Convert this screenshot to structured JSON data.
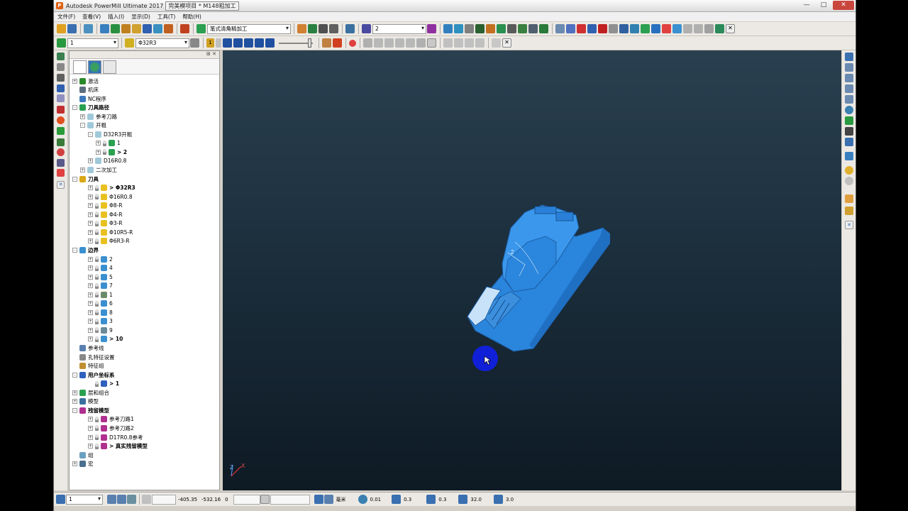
{
  "window": {
    "title": "Autodesk PowerMill Ultimate 2017",
    "project": "完美模项目 * M148粗加工",
    "controls": [
      "—",
      "□",
      "✕"
    ]
  },
  "menu": [
    "文件(F)",
    "查看(V)",
    "插入(I)",
    "显示(D)",
    "工具(T)",
    "帮助(H)"
  ],
  "toolbar1": {
    "strategy_combo": "笔式清角精加工",
    "number_combo": "2"
  },
  "toolbar2": {
    "workplane_combo": "1",
    "tool_combo": "Φ32R3",
    "toolpath_step": "1"
  },
  "explorer": {
    "tree": [
      {
        "label": "激活",
        "indent": 0,
        "expander": "+",
        "color": "#2a8a2a",
        "bold": false
      },
      {
        "label": "机床",
        "indent": 0,
        "expander": "",
        "color": "#5c6f80",
        "bold": false
      },
      {
        "label": "NC程序",
        "indent": 0,
        "expander": "",
        "color": "#3d7abf",
        "bold": false
      },
      {
        "label": "刀具路径",
        "indent": 0,
        "expander": "-",
        "color": "#2aa050",
        "bold": true
      },
      {
        "label": "参考刀路",
        "indent": 1,
        "expander": "+",
        "color": "#9fc9d9",
        "bold": false
      },
      {
        "label": "开粗",
        "indent": 1,
        "expander": "-",
        "color": "#9fc9d9",
        "bold": false
      },
      {
        "label": "D32R3开粗",
        "indent": 2,
        "expander": "-",
        "color": "#9fc9d9",
        "bold": false
      },
      {
        "label": "1",
        "indent": 3,
        "expander": "+",
        "color": "#2aa050",
        "bold": false,
        "bulb": true
      },
      {
        "label": "> 2",
        "indent": 3,
        "expander": "+",
        "color": "#2aa050",
        "bold": true,
        "bulb": true
      },
      {
        "label": "D16R0.8",
        "indent": 2,
        "expander": "+",
        "color": "#9fc9d9",
        "bold": false
      },
      {
        "label": "二次加工",
        "indent": 1,
        "expander": "+",
        "color": "#9fc9d9",
        "bold": false
      },
      {
        "label": "刀具",
        "indent": 0,
        "expander": "-",
        "color": "#d9a818",
        "bold": true
      },
      {
        "label": "> Φ32R3",
        "indent": 2,
        "expander": "+",
        "color": "#e8c020",
        "bold": true,
        "bulb": true
      },
      {
        "label": "Φ16R0.8",
        "indent": 2,
        "expander": "+",
        "color": "#e8c020",
        "bold": false,
        "bulb": true
      },
      {
        "label": "Φ8-R",
        "indent": 2,
        "expander": "+",
        "color": "#e8c020",
        "bold": false,
        "bulb": true
      },
      {
        "label": "Φ4-R",
        "indent": 2,
        "expander": "+",
        "color": "#e8c020",
        "bold": false,
        "bulb": true
      },
      {
        "label": "Φ3-R",
        "indent": 2,
        "expander": "+",
        "color": "#e8c020",
        "bold": false,
        "bulb": true
      },
      {
        "label": "Φ10R5-R",
        "indent": 2,
        "expander": "+",
        "color": "#e8c020",
        "bold": false,
        "bulb": true
      },
      {
        "label": "Φ6R3-R",
        "indent": 2,
        "expander": "+",
        "color": "#e8c020",
        "bold": false,
        "bulb": true
      },
      {
        "label": "边界",
        "indent": 0,
        "expander": "-",
        "color": "#3a8fd0",
        "bold": true
      },
      {
        "label": "2",
        "indent": 2,
        "expander": "+",
        "color": "#3a8fd0",
        "bold": false,
        "bulb": true
      },
      {
        "label": "4",
        "indent": 2,
        "expander": "+",
        "color": "#3a8fd0",
        "bold": false,
        "bulb": true
      },
      {
        "label": "5",
        "indent": 2,
        "expander": "+",
        "color": "#3a8fd0",
        "bold": false,
        "bulb": true
      },
      {
        "label": "7",
        "indent": 2,
        "expander": "+",
        "color": "#3a8fd0",
        "bold": false,
        "bulb": true
      },
      {
        "label": "1",
        "indent": 2,
        "expander": "+",
        "color": "#6a8a6a",
        "bold": false,
        "bulb": true
      },
      {
        "label": "6",
        "indent": 2,
        "expander": "+",
        "color": "#3a8fd0",
        "bold": false,
        "bulb": true
      },
      {
        "label": "8",
        "indent": 2,
        "expander": "+",
        "color": "#3a8fd0",
        "bold": false,
        "bulb": true
      },
      {
        "label": "3",
        "indent": 2,
        "expander": "+",
        "color": "#3a8fd0",
        "bold": false,
        "bulb": true
      },
      {
        "label": "9",
        "indent": 2,
        "expander": "+",
        "color": "#6a8a9a",
        "bold": false,
        "bulb": true
      },
      {
        "label": "> 10",
        "indent": 2,
        "expander": "+",
        "color": "#3a8fd0",
        "bold": true,
        "bulb": true
      },
      {
        "label": "参考线",
        "indent": 0,
        "expander": "",
        "color": "#5a7fb0",
        "bold": false
      },
      {
        "label": "孔特征设置",
        "indent": 0,
        "expander": "",
        "color": "#888888",
        "bold": false
      },
      {
        "label": "特征组",
        "indent": 0,
        "expander": "",
        "color": "#c09030",
        "bold": false
      },
      {
        "label": "用户坐标系",
        "indent": 0,
        "expander": "-",
        "color": "#3060c0",
        "bold": true
      },
      {
        "label": "> 1",
        "indent": 2,
        "expander": "",
        "color": "#3060c0",
        "bold": true,
        "bulb": true
      },
      {
        "label": "层和组合",
        "indent": 0,
        "expander": "+",
        "color": "#2aa050",
        "bold": false
      },
      {
        "label": "模型",
        "indent": 0,
        "expander": "+",
        "color": "#3a6fa0",
        "bold": false
      },
      {
        "label": "残留模型",
        "indent": 0,
        "expander": "-",
        "color": "#b03090",
        "bold": true
      },
      {
        "label": "参考刀路1",
        "indent": 2,
        "expander": "+",
        "color": "#b03090",
        "bold": false,
        "bulb": true
      },
      {
        "label": "参考刀路2",
        "indent": 2,
        "expander": "+",
        "color": "#b03090",
        "bold": false,
        "bulb": true
      },
      {
        "label": "D17R0.8参考",
        "indent": 2,
        "expander": "+",
        "color": "#b03090",
        "bold": false,
        "bulb": true
      },
      {
        "label": "> 真实残留模型",
        "indent": 2,
        "expander": "+",
        "color": "#b03090",
        "bold": true,
        "bulb": true
      },
      {
        "label": "组",
        "indent": 0,
        "expander": "",
        "color": "#6aa0c0",
        "bold": false
      },
      {
        "label": "宏",
        "indent": 0,
        "expander": "+",
        "color": "#4a6f8f",
        "bold": false
      }
    ]
  },
  "viewport": {
    "model_color": "#2f8fe6",
    "background_top": "#2a4050",
    "background_bottom": "#0e1a24",
    "model_label": "2",
    "axis_labels": [
      "Z",
      "X"
    ]
  },
  "status": {
    "workplane": "1",
    "x": "-405.35",
    "y": "-532.16",
    "z": "0",
    "units": "毫米",
    "tolerance": "0.01",
    "thickness": "0.3",
    "stepover": "0.3",
    "diameter": "32.0",
    "stepdown": "3.0"
  }
}
